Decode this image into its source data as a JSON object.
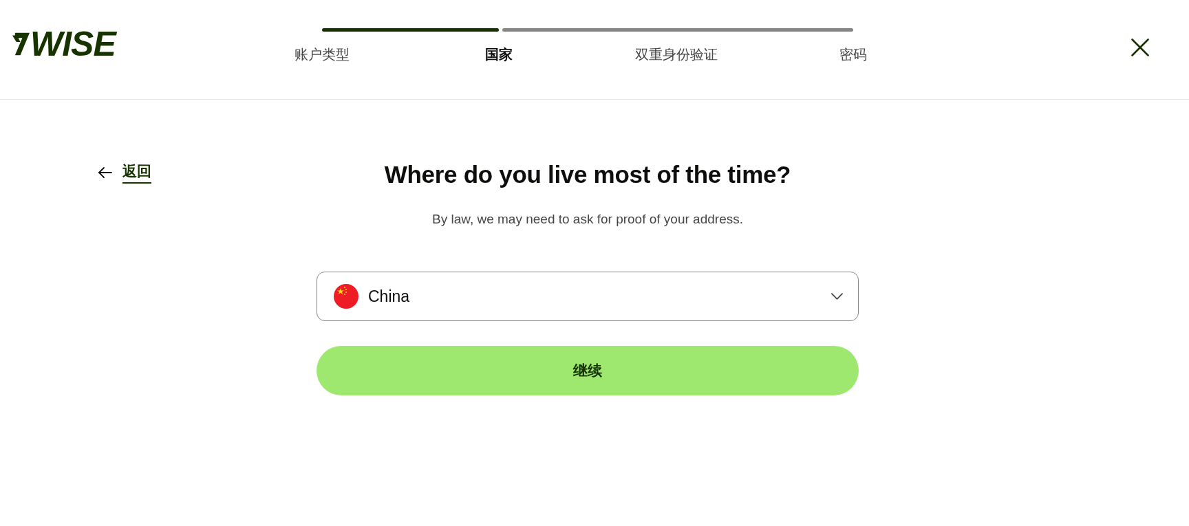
{
  "header": {
    "logo": {
      "text": "WISE"
    },
    "progress": {
      "level": 0.3333
    },
    "steps": [
      {
        "label": "账户类型",
        "selected": false
      },
      {
        "label": "国家",
        "selected": true
      },
      {
        "label": "双重身份验证",
        "selected": false
      },
      {
        "label": "密码",
        "selected": false
      }
    ]
  },
  "back_link": {
    "label": "返回"
  },
  "question": {
    "title": "Where do you live most of the time?",
    "subtitle": "By law, we may need to ask for proof of your address."
  },
  "country_select": {
    "value": "China"
  },
  "continue_button": {
    "label": "继续"
  }
}
